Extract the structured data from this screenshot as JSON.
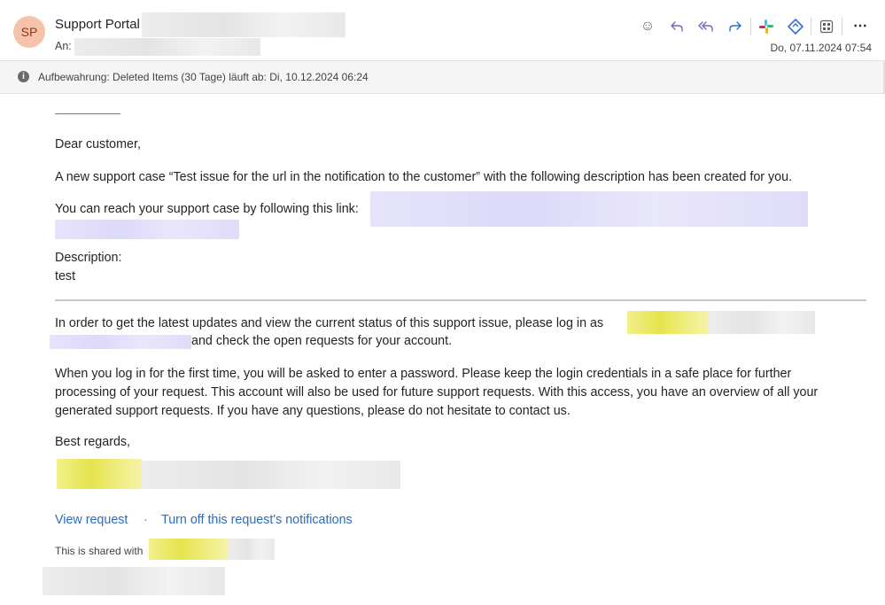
{
  "header": {
    "avatar_initials": "SP",
    "sender": "Support Portal",
    "to_label": "An:",
    "date": "Do, 07.11.2024 07:54",
    "toolbar": {
      "emoji_icon": "smile-icon",
      "reply_icon": "reply-icon",
      "reply_all_icon": "reply-all-icon",
      "forward_icon": "forward-icon",
      "slack_icon": "slack-icon",
      "addin_icon": "diamond-addin-icon",
      "apps_icon": "apps-icon",
      "more_icon": "more-icon"
    }
  },
  "retention": {
    "text": "Aufbewahrung: Deleted Items (30 Tage) läuft ab: Di, 10.12.2024 06:24"
  },
  "email": {
    "greeting": "Dear customer,",
    "paragraph1": "A new support case “Test issue for the url in the notification to the customer” with the following description has been created for you.",
    "reach_text": "You can reach your support case by following this link:",
    "description_label": "Description:",
    "description_value": "test",
    "login_text_start": "In order to get the latest updates and view the current status of this support issue, please log in as",
    "login_text_end": "and check the open requests for your account.",
    "paragraph_first_login_1": "When you log in for the first time, you will be asked to enter a password. Please keep the login credentials in a safe place for further",
    "paragraph_first_login_2": "processing of your request. This account will also be used for future support requests. With this access, you have an overview of all your",
    "paragraph_first_login_3": "generated support requests. If you have any questions, please do not hesitate to contact us.",
    "closing": "Best regards,",
    "view_request": "View request",
    "separator": "·",
    "turn_off": "Turn off this request's notifications",
    "shared_with": "This is shared with"
  },
  "colors": {
    "link": "#2e6bb8",
    "avatar_bg": "#f4c3aa",
    "reply_purple": "#7b63c9"
  }
}
